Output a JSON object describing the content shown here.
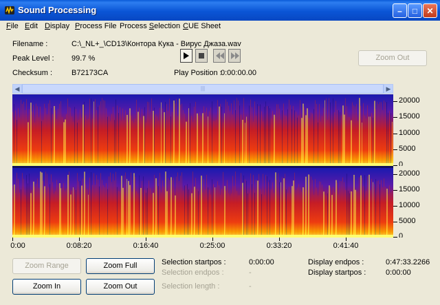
{
  "window": {
    "title": "Sound Processing"
  },
  "menu": [
    "File",
    "Edit",
    "Display",
    "Process File",
    "Process Selection",
    "CUE Sheet"
  ],
  "menu_underline": [
    "F",
    "E",
    "D",
    "P",
    "S",
    "C"
  ],
  "info": {
    "filename_label": "Filename :",
    "filename_value": "C:\\_NL+_\\CD13\\Контора Кука - Вирус Джаза.wav",
    "peak_label": "Peak Level :",
    "peak_value": "99.7 %",
    "checksum_label": "Checksum :",
    "checksum_value": "B72173CA",
    "play_position_label": "Play Position :",
    "play_position_value": "0:00:00.00"
  },
  "buttons": {
    "zoom_out_top": "Zoom Out",
    "zoom_range": "Zoom Range",
    "zoom_full": "Zoom Full",
    "zoom_in": "Zoom In",
    "zoom_out": "Zoom Out"
  },
  "freq_ticks": [
    "20000",
    "15000",
    "10000",
    "5000",
    "0"
  ],
  "time_ticks": [
    "0:00",
    "0:08:20",
    "0:16:40",
    "0:25:00",
    "0:33:20",
    "0:41:40"
  ],
  "selection": {
    "startpos_label": "Selection startpos :",
    "startpos_value": "0:00:00",
    "endpos_label": "Selection endpos :",
    "endpos_value": "-",
    "length_label": "Selection length :",
    "length_value": "-"
  },
  "display": {
    "endpos_label": "Display endpos :",
    "endpos_value": "0:47:33.2266",
    "startpos_label": "Display startpos :",
    "startpos_value": "0:00:00"
  }
}
